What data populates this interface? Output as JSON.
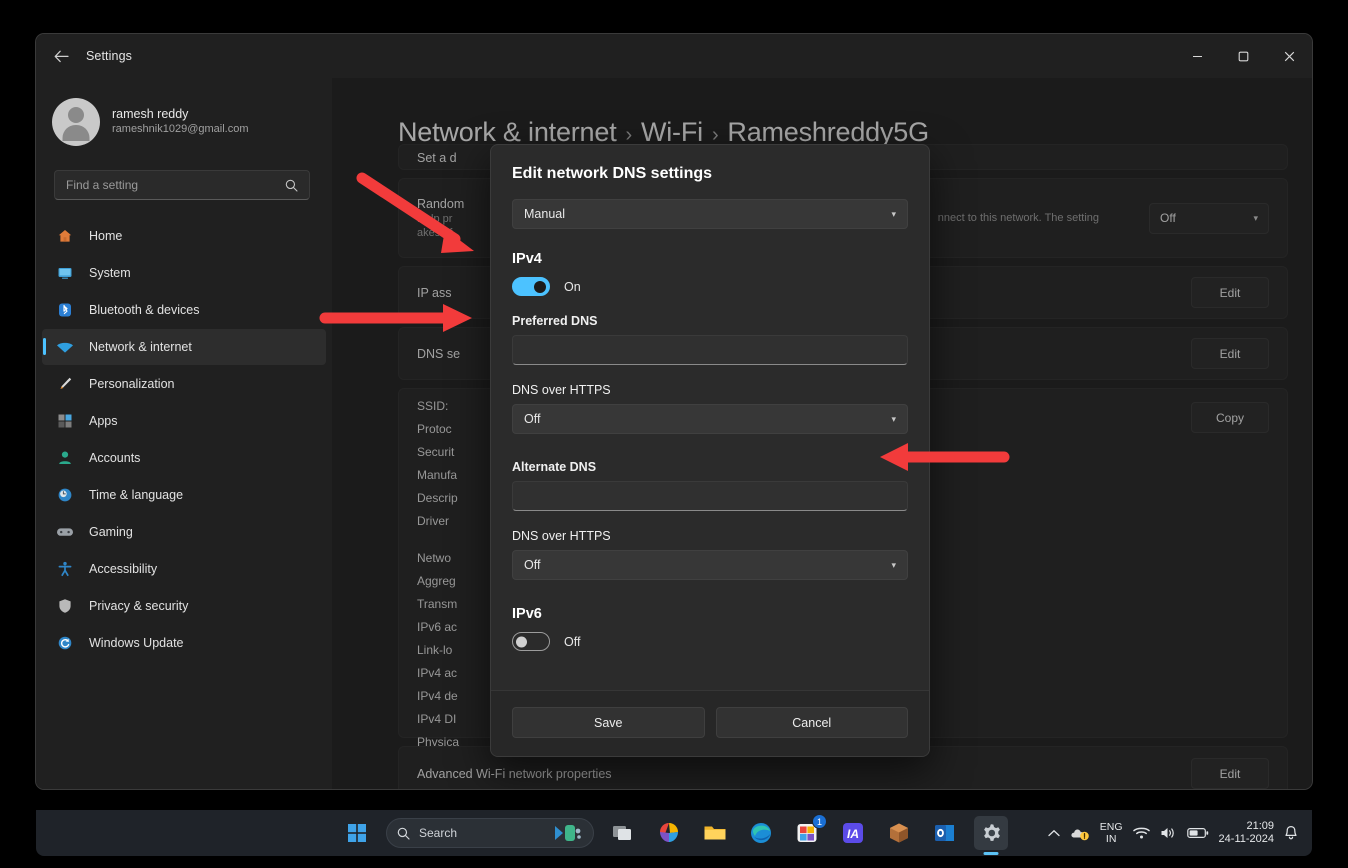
{
  "window": {
    "title": "Settings",
    "back_icon": "back-arrow-icon",
    "minimize": "–",
    "maximize": "❐",
    "close": "✕"
  },
  "account": {
    "name": "ramesh reddy",
    "email": "rameshnik1029@gmail.com"
  },
  "search": {
    "placeholder": "Find a setting",
    "icon": "search-icon"
  },
  "sidebar": {
    "items": [
      {
        "label": "Home",
        "icon": "home-icon",
        "active": false
      },
      {
        "label": "System",
        "icon": "system-icon",
        "active": false
      },
      {
        "label": "Bluetooth & devices",
        "icon": "bluetooth-icon",
        "active": false
      },
      {
        "label": "Network & internet",
        "icon": "wifi-icon",
        "active": true
      },
      {
        "label": "Personalization",
        "icon": "brush-icon",
        "active": false
      },
      {
        "label": "Apps",
        "icon": "apps-icon",
        "active": false
      },
      {
        "label": "Accounts",
        "icon": "accounts-icon",
        "active": false
      },
      {
        "label": "Time & language",
        "icon": "clock-icon",
        "active": false
      },
      {
        "label": "Gaming",
        "icon": "gamepad-icon",
        "active": false
      },
      {
        "label": "Accessibility",
        "icon": "accessibility-icon",
        "active": false
      },
      {
        "label": "Privacy & security",
        "icon": "shield-icon",
        "active": false
      },
      {
        "label": "Windows Update",
        "icon": "update-icon",
        "active": false
      }
    ]
  },
  "breadcrumb": {
    "root": "Network & internet",
    "sep1": "›",
    "level2": "Wi-Fi",
    "sep2": "›",
    "level3": "Rameshreddy5G"
  },
  "page": {
    "top_row_clipped": "Set a d",
    "random_title": "Random",
    "random_sub1": "Help pr",
    "random_sub2": "akes ef",
    "random_right": "nnect to this network. The setting",
    "random_combo_value": "Off",
    "ip_assignment": "IP ass",
    "ip_edit_label": "Edit",
    "dns_setting": "DNS se",
    "dns_edit_label": "Edit",
    "copy_label": "Copy",
    "info_rows": [
      "SSID:",
      "Protoc",
      "Securit",
      "Manufa",
      "Descrip",
      "Driver "
    ],
    "info_rows2": [
      "Netwo",
      "Aggreg",
      "Transm",
      "IPv6 ac",
      "Link-lo",
      "IPv4 ac",
      "IPv4 de",
      "IPv4 DI",
      "Physica"
    ],
    "advanced_label": "Advanced Wi-Fi network properties",
    "advanced_edit": "Edit"
  },
  "dialog": {
    "title": "Edit network DNS settings",
    "mode_value": "Manual",
    "chevron": "⌄",
    "ipv4": {
      "heading": "IPv4",
      "toggle_state": "On",
      "toggle_on": true,
      "preferred_label": "Preferred DNS",
      "preferred_value": "",
      "doh_label": "DNS over HTTPS",
      "doh_value": "Off",
      "alternate_label": "Alternate DNS",
      "alternate_value": "",
      "doh2_label": "DNS over HTTPS",
      "doh2_value": "Off"
    },
    "ipv6": {
      "heading": "IPv6",
      "toggle_state": "Off",
      "toggle_on": false
    },
    "save_label": "Save",
    "cancel_label": "Cancel"
  },
  "annotations": {
    "color": "#f23b3b",
    "arrows": [
      {
        "name": "arrow-to-ipv4-toggle",
        "direction": "diagonal-down-right"
      },
      {
        "name": "arrow-to-preferred-dns",
        "direction": "right"
      },
      {
        "name": "arrow-to-alternate-dns",
        "direction": "left"
      }
    ]
  },
  "taskbar": {
    "start_icon": "windows-start-icon",
    "search_label": "Search",
    "search_icon": "search-icon",
    "apps": [
      {
        "name": "copilot-icon"
      },
      {
        "name": "task-view-icon"
      },
      {
        "name": "microsoft-365-icon"
      },
      {
        "name": "file-explorer-icon"
      },
      {
        "name": "edge-icon"
      },
      {
        "name": "store-icon",
        "badge": "1"
      },
      {
        "name": "adobe-illustrator-icon"
      },
      {
        "name": "package-app-icon"
      },
      {
        "name": "outlook-icon"
      },
      {
        "name": "settings-icon",
        "active": true
      }
    ],
    "tray": {
      "chevron_icon": "show-hidden-icons-chevron",
      "onedrive_icon": "onedrive-warning-icon",
      "language_line1": "ENG",
      "language_line2": "IN",
      "wifi_icon": "wifi-icon",
      "volume_icon": "volume-icon",
      "battery_icon": "battery-icon",
      "time": "21:09",
      "date": "24-11-2024",
      "notification_icon": "notification-bell-icon"
    }
  }
}
